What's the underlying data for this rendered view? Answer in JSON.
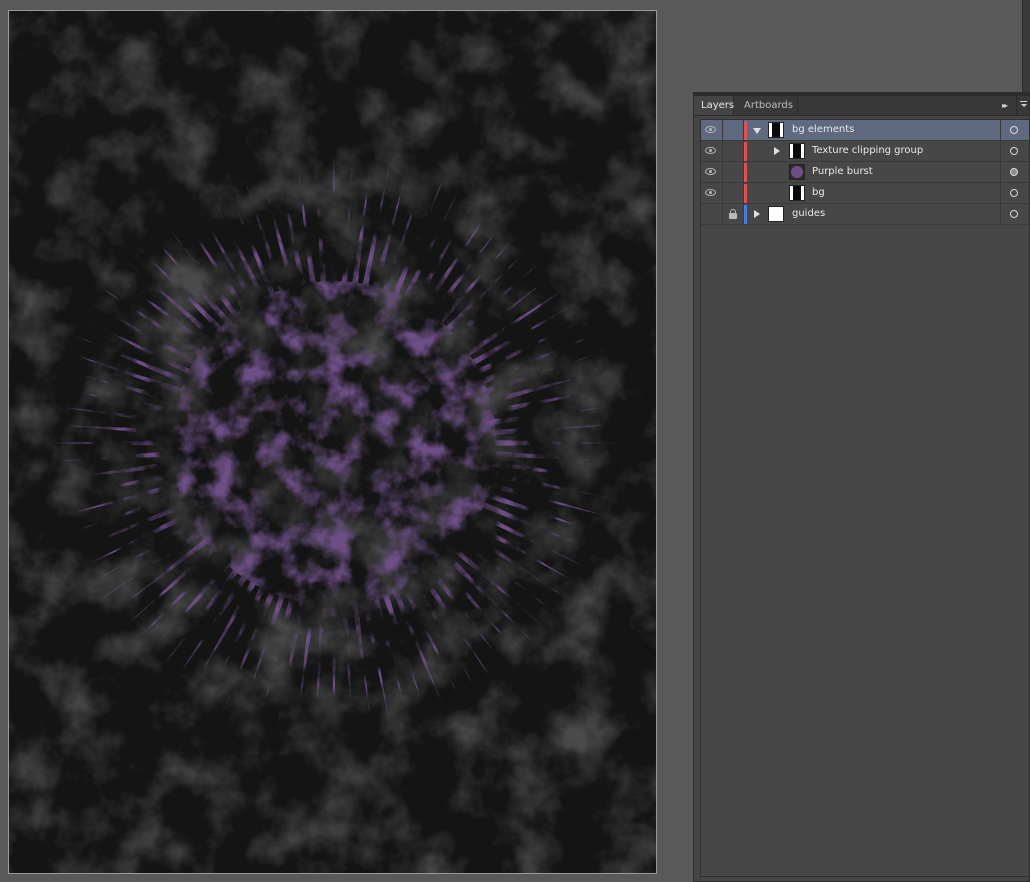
{
  "artboard": {
    "background_color": "#121212",
    "burst_color": "#6d4f86"
  },
  "layers_panel": {
    "tabs": [
      {
        "label": "Layers",
        "active": true
      },
      {
        "label": "Artboards",
        "active": false
      }
    ],
    "collapse_glyph": "▸▸",
    "rows": [
      {
        "label": "bg elements",
        "visible": true,
        "locked": false,
        "layer_color": "#e05050",
        "expanded": true,
        "thumbnail": "dark",
        "selected": true,
        "target": "hollow"
      },
      {
        "label": "Texture clipping group",
        "visible": true,
        "locked": false,
        "layer_color": "#e05050",
        "expanded": false,
        "thumbnail": "dark",
        "selected": false,
        "target": "hollow"
      },
      {
        "label": "Purple burst",
        "visible": true,
        "locked": false,
        "layer_color": "#e05050",
        "thumbnail": "burst",
        "selected": false,
        "target": "filled"
      },
      {
        "label": "bg",
        "visible": true,
        "locked": false,
        "layer_color": "#e05050",
        "thumbnail": "dark",
        "selected": false,
        "target": "hollow"
      },
      {
        "label": "guides",
        "visible": false,
        "locked": true,
        "layer_color": "#4a7be0",
        "expanded": false,
        "thumbnail": "white",
        "selected": false,
        "target": "hollow"
      }
    ]
  }
}
